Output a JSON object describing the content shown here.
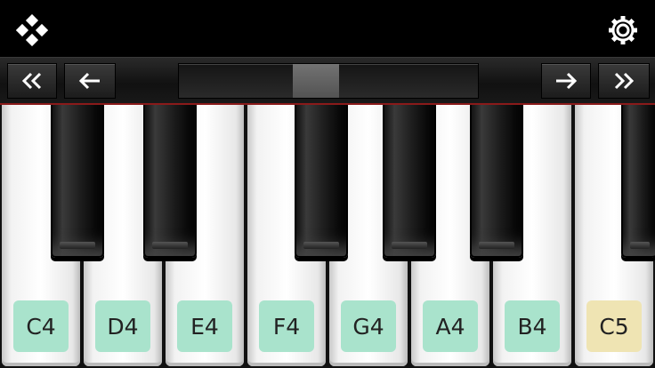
{
  "header": {
    "menu_icon": "diamond-dots-icon",
    "settings_icon": "gear-icon"
  },
  "navigation": {
    "buttons": [
      {
        "name": "scroll-far-left",
        "icon": "double-left-arrow-icon"
      },
      {
        "name": "scroll-left",
        "icon": "left-arrow-icon"
      },
      {
        "name": "scroll-right",
        "icon": "right-arrow-icon"
      },
      {
        "name": "scroll-far-right",
        "icon": "double-right-arrow-icon"
      }
    ],
    "slider_position": 0.45
  },
  "keyboard": {
    "white_keys": [
      {
        "label": "C4",
        "highlight": "#a9e3cc"
      },
      {
        "label": "D4",
        "highlight": "#a9e3cc"
      },
      {
        "label": "E4",
        "highlight": "#a9e3cc"
      },
      {
        "label": "F4",
        "highlight": "#a9e3cc"
      },
      {
        "label": "G4",
        "highlight": "#a9e3cc"
      },
      {
        "label": "A4",
        "highlight": "#a9e3cc"
      },
      {
        "label": "B4",
        "highlight": "#a9e3cc"
      },
      {
        "label": "C5",
        "highlight": "#efe4b3"
      }
    ],
    "black_key_count": 6
  },
  "colors": {
    "accent_line": "#8a1a1a",
    "white_key_label_bg": "#a9e3cc",
    "octave_label_bg": "#efe4b3"
  }
}
